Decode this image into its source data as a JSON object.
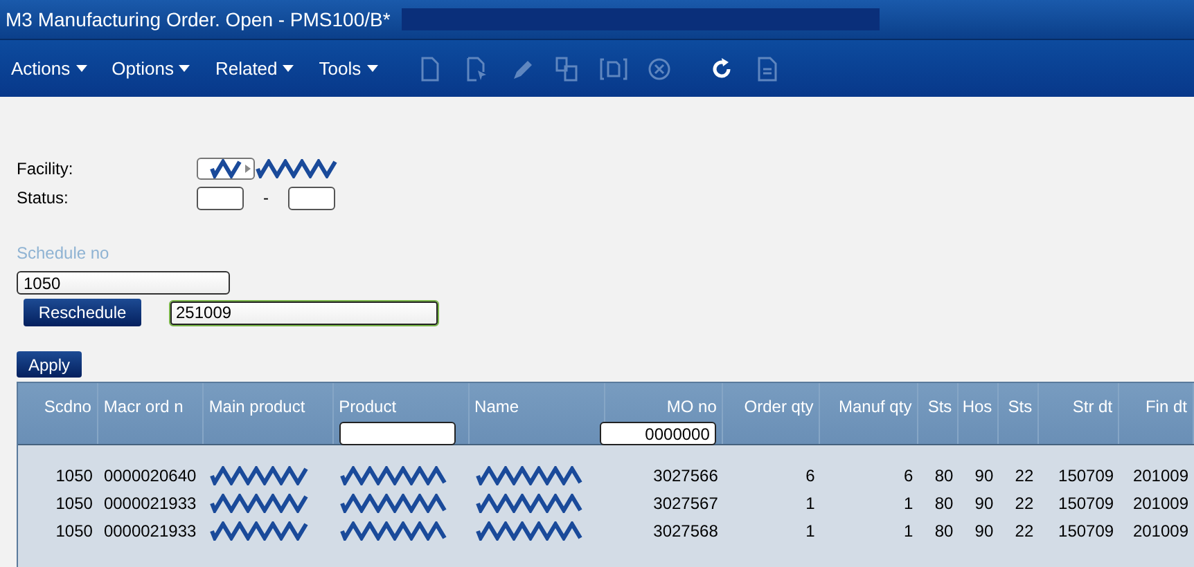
{
  "window": {
    "title": "M3 Manufacturing Order. Open - PMS100/B*"
  },
  "menus": [
    {
      "label": "Actions"
    },
    {
      "label": "Options"
    },
    {
      "label": "Related"
    },
    {
      "label": "Tools"
    }
  ],
  "toolbar": [
    {
      "kind": "new",
      "disabled": true
    },
    {
      "kind": "select",
      "disabled": true
    },
    {
      "kind": "edit",
      "disabled": true
    },
    {
      "kind": "copy",
      "disabled": true
    },
    {
      "kind": "display",
      "disabled": true
    },
    {
      "kind": "delete",
      "disabled": true
    },
    {
      "kind": "refresh",
      "disabled": false
    },
    {
      "kind": "document",
      "disabled": true
    }
  ],
  "filters": {
    "facility_label": "Facility:",
    "status_label": "Status:",
    "status_separator": "-"
  },
  "schedule": {
    "label": "Schedule no",
    "value": "1050",
    "reschedule_button": "Reschedule",
    "reschedule_value": "251009"
  },
  "apply_button": "Apply",
  "table": {
    "columns": [
      {
        "label": "Scdno"
      },
      {
        "label": "Macr ord n"
      },
      {
        "label": "Main product"
      },
      {
        "label": "Product",
        "filter_field": true
      },
      {
        "label": "Name"
      },
      {
        "label": "MO no",
        "filter_field": true,
        "filter_value": "0000000"
      },
      {
        "label": "Order qty"
      },
      {
        "label": "Manuf qty"
      },
      {
        "label": "Sts"
      },
      {
        "label": "Hos"
      },
      {
        "label": "Sts"
      },
      {
        "label": "Str dt"
      },
      {
        "label": "Fin dt"
      }
    ],
    "rows": [
      {
        "cells": [
          {
            "kind": "text",
            "text": "1050"
          },
          {
            "kind": "text",
            "text": "0000020640"
          },
          {
            "kind": "redacted"
          },
          {
            "kind": "redacted"
          },
          {
            "kind": "redacted"
          },
          {
            "kind": "text",
            "text": "3027566"
          },
          {
            "kind": "text",
            "text": "6"
          },
          {
            "kind": "text",
            "text": "6"
          },
          {
            "kind": "text",
            "text": "80"
          },
          {
            "kind": "text",
            "text": "90"
          },
          {
            "kind": "text",
            "text": "22"
          },
          {
            "kind": "text",
            "text": "150709"
          },
          {
            "kind": "text",
            "text": "201009"
          }
        ]
      },
      {
        "cells": [
          {
            "kind": "text",
            "text": "1050"
          },
          {
            "kind": "text",
            "text": "0000021933"
          },
          {
            "kind": "redacted"
          },
          {
            "kind": "redacted"
          },
          {
            "kind": "redacted"
          },
          {
            "kind": "text",
            "text": "3027567"
          },
          {
            "kind": "text",
            "text": "1"
          },
          {
            "kind": "text",
            "text": "1"
          },
          {
            "kind": "text",
            "text": "80"
          },
          {
            "kind": "text",
            "text": "90"
          },
          {
            "kind": "text",
            "text": "22"
          },
          {
            "kind": "text",
            "text": "150709"
          },
          {
            "kind": "text",
            "text": "201009"
          }
        ]
      },
      {
        "cells": [
          {
            "kind": "text",
            "text": "1050"
          },
          {
            "kind": "text",
            "text": "0000021933"
          },
          {
            "kind": "redacted"
          },
          {
            "kind": "redacted"
          },
          {
            "kind": "redacted"
          },
          {
            "kind": "text",
            "text": "3027568"
          },
          {
            "kind": "text",
            "text": "1"
          },
          {
            "kind": "text",
            "text": "1"
          },
          {
            "kind": "text",
            "text": "80"
          },
          {
            "kind": "text",
            "text": "90"
          },
          {
            "kind": "text",
            "text": "22"
          },
          {
            "kind": "text",
            "text": "150709"
          },
          {
            "kind": "text",
            "text": "201009"
          }
        ]
      }
    ]
  }
}
